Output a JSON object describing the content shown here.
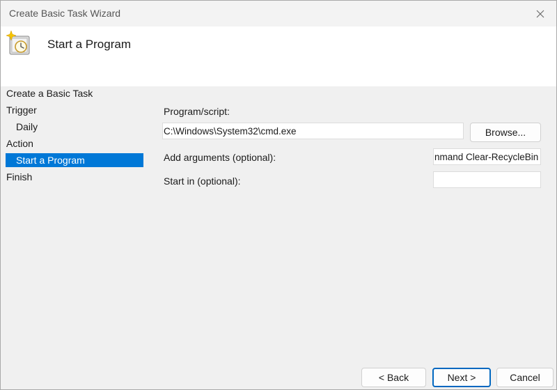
{
  "window": {
    "title": "Create Basic Task Wizard",
    "close_icon": "close-icon"
  },
  "header": {
    "icon": "task-scheduler-clock-icon",
    "title": "Start a Program"
  },
  "nav": {
    "items": [
      {
        "label": "Create a Basic Task",
        "level": 0,
        "selected": false
      },
      {
        "label": "Trigger",
        "level": 0,
        "selected": false
      },
      {
        "label": "Daily",
        "level": 1,
        "selected": false
      },
      {
        "label": "Action",
        "level": 0,
        "selected": false
      },
      {
        "label": "Start a Program",
        "level": 1,
        "selected": true
      },
      {
        "label": "Finish",
        "level": 0,
        "selected": false
      }
    ]
  },
  "form": {
    "program_label": "Program/script:",
    "program_value": "C:\\Windows\\System32\\cmd.exe",
    "browse_label": "Browse...",
    "arguments_label": "Add arguments (optional):",
    "arguments_value": "nmand Clear-RecycleBin\"",
    "start_in_label": "Start in (optional):",
    "start_in_value": ""
  },
  "buttons": {
    "back": "< Back",
    "next": "Next >",
    "cancel": "Cancel"
  },
  "colors": {
    "selection": "#0078d7",
    "default_button_border": "#0067c0"
  }
}
